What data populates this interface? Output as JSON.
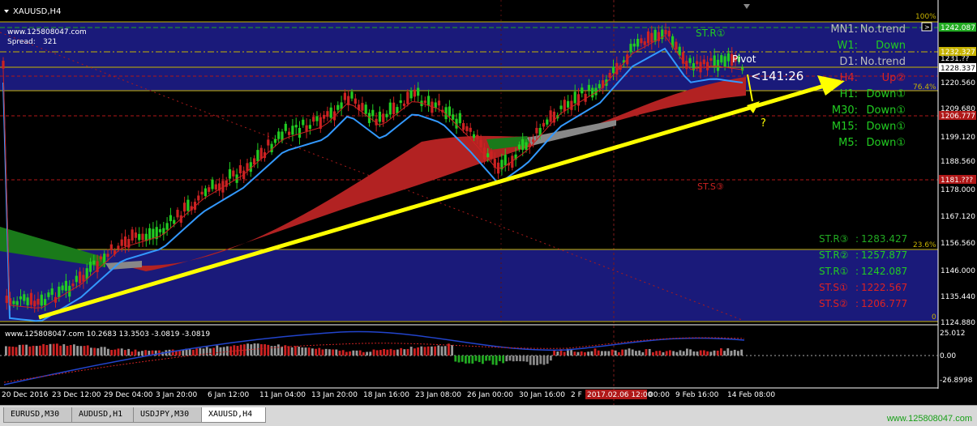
{
  "window": {
    "symbol_title": "XAUUSD,H4",
    "menu_arrow_icon": "triangle-down-icon"
  },
  "info": {
    "site": "www.125808047.com",
    "spread_label": "Spread:",
    "spread_value": "321"
  },
  "price_axis": {
    "levels": [
      "1242.087",
      "1232.327",
      "1231.??",
      "1228.337",
      "1220.560",
      "1209.680",
      "1206.777",
      "1199.120",
      "1188.560",
      "1181.??",
      "1178.000",
      "1167.120",
      "1156.560",
      "1146.000",
      "1135.440",
      "1124.880"
    ],
    "highlighted": [
      {
        "text": "1242.087",
        "color": "#22aa22"
      },
      {
        "text": "1232.327",
        "color": "#c8b400"
      },
      {
        "text": "1228.337",
        "color": "#ffffff"
      },
      {
        "text": "1206.777",
        "color": "#b01818"
      },
      {
        "text": "1181.???",
        "color": "#b01818"
      }
    ]
  },
  "fibo_labels": {
    "top": "100%",
    "f764": "76.4%",
    "f236": "23.6%",
    "zero": "0"
  },
  "trend_panel": [
    {
      "tf": "MN1:",
      "state": "No.trend",
      "color": "#bbbbbb"
    },
    {
      "tf": "W1:",
      "state": "Down",
      "color": "#22cc22"
    },
    {
      "tf": "D1:",
      "state": "No.trend",
      "color": "#bbbbbb"
    },
    {
      "tf": "H4:",
      "state": "Up②",
      "color": "#dd2222"
    },
    {
      "tf": "H1:",
      "state": "Down①",
      "color": "#22cc22"
    },
    {
      "tf": "M30:",
      "state": "Down①",
      "color": "#22cc22"
    },
    {
      "tf": "M15:",
      "state": "Down①",
      "color": "#22cc22"
    },
    {
      "tf": "M5:",
      "state": "Down①",
      "color": "#22cc22"
    }
  ],
  "level_panel": [
    {
      "label": "ST.R③",
      "value": "1283.427",
      "color": "#22aa22"
    },
    {
      "label": "ST.R②",
      "value": "1257.877",
      "color": "#22cc22"
    },
    {
      "label": "ST.R①",
      "value": "1242.087",
      "color": "#22cc22"
    },
    {
      "label": "ST.S①",
      "value": "1222.567",
      "color": "#dd2222"
    },
    {
      "label": "ST.S②",
      "value": "1206.777",
      "color": "#dd2222"
    }
  ],
  "annotations": {
    "st_r1": "ST.R①",
    "st_s3": "ST.S③",
    "pivot": "Pivot",
    "countdown": "<141:26",
    "question": "?"
  },
  "indicator": {
    "title": "www.125808047.com 10.2683 13.3503 -3.0819 -3.0819",
    "scale": [
      "25.012",
      "0.00",
      "-26.8998"
    ]
  },
  "time_axis": [
    "20 Dec 2016",
    "23 Dec 12:00",
    "29 Dec 04:00",
    "3 Jan 20:00",
    "6 Jan 12:00",
    "11 Jan 04:00",
    "13 Jan 20:00",
    "18 Jan 16:00",
    "23 Jan 08:00",
    "26 Jan 00:00",
    "30 Jan 16:00",
    "2 F",
    "2017.02.06 12:00",
    "00:00",
    "9 Feb 16:00",
    "14 Feb 08:00"
  ],
  "tabs": [
    {
      "label": "EURUSD,M30",
      "active": false
    },
    {
      "label": "AUDUSD,H1",
      "active": false
    },
    {
      "label": "USDJPY,M30",
      "active": false
    },
    {
      "label": "XAUUSD,H4",
      "active": true
    }
  ],
  "footer_site": "www.125808047.com",
  "colors": {
    "band": "#1a1a7a",
    "bull": "#22cc22",
    "bear": "#cc2222",
    "cloud_red": "#b22222",
    "cloud_green": "#1a8a1a",
    "trendline": "#ffff00",
    "ma": "#3399ff"
  }
}
